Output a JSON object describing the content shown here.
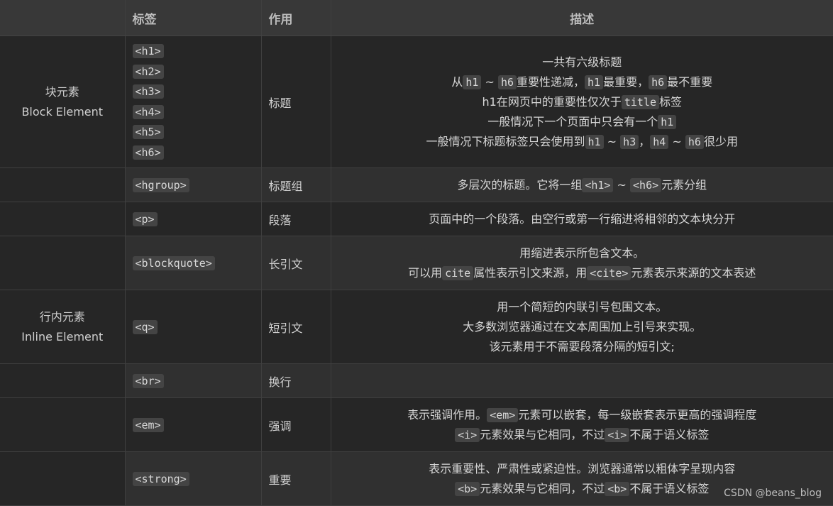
{
  "headers": [
    "",
    "标签",
    "作用",
    "描述"
  ],
  "groups": {
    "block": {
      "zh": "块元素",
      "en": "Block Element"
    },
    "inline": {
      "zh": "行内元素",
      "en": "Inline Element"
    }
  },
  "rows": [
    {
      "tags": [
        "<h1>",
        "<h2>",
        "<h3>",
        "<h4>",
        "<h5>",
        "<h6>"
      ],
      "role": "标题",
      "desc": [
        {
          "t1": "一共有六级标题"
        },
        {
          "t1": "从",
          "c1": "h1",
          "t2": " ~ ",
          "c2": "h6",
          "t3": "重要性递减，",
          "c3": "h1",
          "t4": "最重要，",
          "c4": "h6",
          "t5": "最不重要"
        },
        {
          "t1": "h1在网页中的重要性仅次于",
          "c1": "title",
          "t2": "标签"
        },
        {
          "t1": "一般情况下一个页面中只会有一个",
          "c1": "h1"
        },
        {
          "t1": "一般情况下标题标签只会使用到",
          "c1": "h1",
          "t2": " ~ ",
          "c2": "h3",
          "t3": "，",
          "c3": "h4",
          "t4": " ~ ",
          "c4": "h6",
          "t5": "很少用"
        }
      ]
    },
    {
      "tags": [
        "<hgroup>"
      ],
      "role": "标题组",
      "desc": [
        {
          "t1": "多层次的标题。它将一组",
          "c1": "<h1>",
          "t2": " ~ ",
          "c2": "<h6>",
          "t3": "元素分组"
        }
      ]
    },
    {
      "tags": [
        "<p>"
      ],
      "role": "段落",
      "desc": [
        {
          "t1": "页面中的一个段落。由空行或第一行缩进将相邻的文本块分开"
        }
      ]
    },
    {
      "tags": [
        "<blockquote>"
      ],
      "role": "长引文",
      "desc": [
        {
          "t1": "用缩进表示所包含文本。"
        },
        {
          "t1": "可以用",
          "c1": "cite",
          "t2": "属性表示引文来源，用",
          "c2": "<cite>",
          "t3": "元素表示来源的文本表述"
        }
      ]
    },
    {
      "tags": [
        "<q>"
      ],
      "role": "短引文",
      "desc": [
        {
          "t1": "用一个简短的内联引号包围文本。"
        },
        {
          "t1": "大多数浏览器通过在文本周围加上引号来实现。"
        },
        {
          "t1": "该元素用于不需要段落分隔的短引文;"
        }
      ]
    },
    {
      "tags": [
        "<br>"
      ],
      "role": "换行",
      "desc": []
    },
    {
      "tags": [
        "<em>"
      ],
      "role": "强调",
      "desc": [
        {
          "t1": "表示强调作用。",
          "c1": "<em>",
          "t2": "元素可以嵌套，每一级嵌套表示更高的强调程度"
        },
        {
          "c1": "<i>",
          "t2": "元素效果与它相同，不过",
          "c2": "<i>",
          "t3": "不属于语义标签"
        }
      ]
    },
    {
      "tags": [
        "<strong>"
      ],
      "role": "重要",
      "desc": [
        {
          "t1": "表示重要性、严肃性或紧迫性。浏览器通常以粗体字呈现内容"
        },
        {
          "c1": "<b>",
          "t2": "元素效果与它相同，不过",
          "c2": "<b>",
          "t3": "不属于语义标签"
        }
      ]
    }
  ],
  "watermark": "CSDN @beans_blog"
}
